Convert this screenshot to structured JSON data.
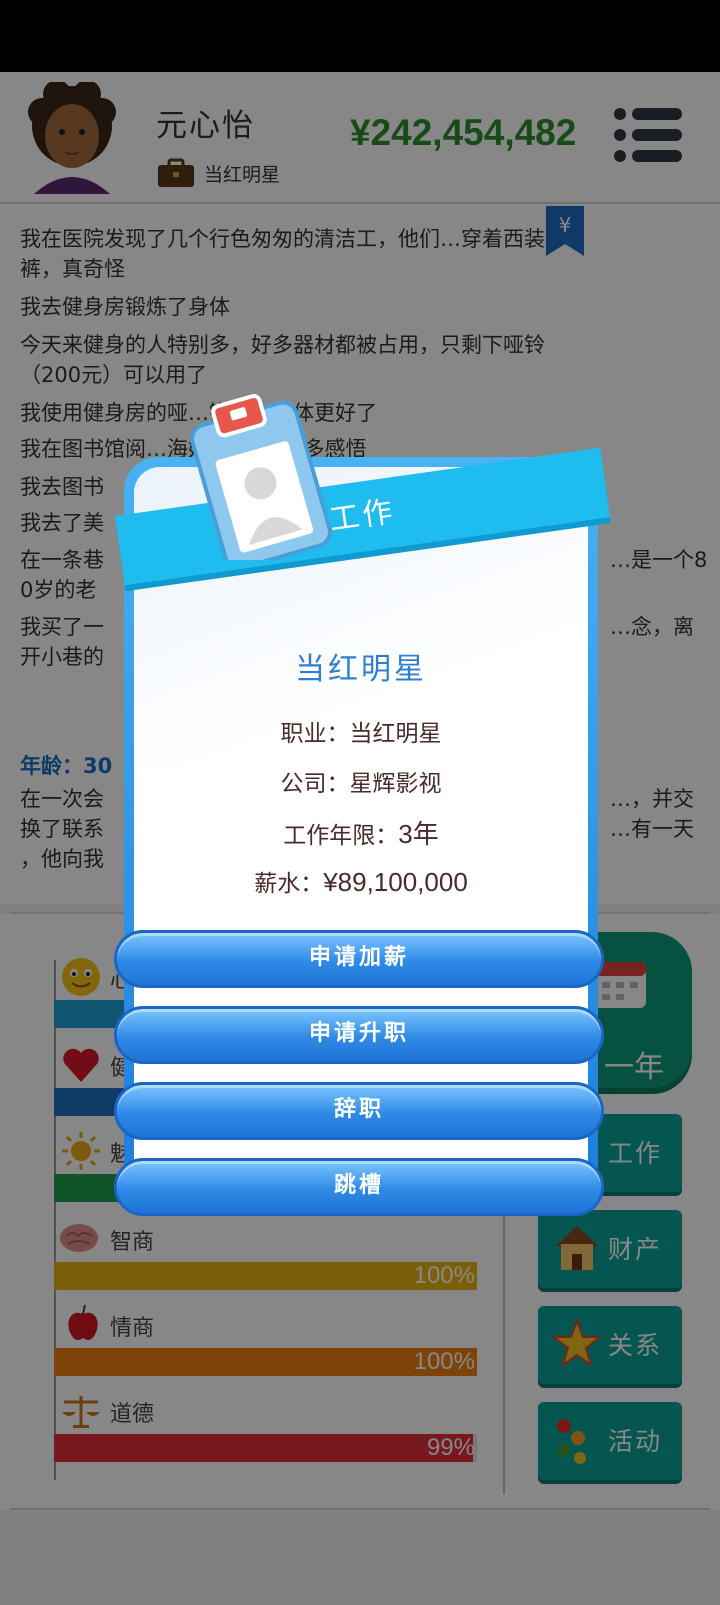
{
  "header": {
    "player_name": "元心怡",
    "job_title": "当红明星",
    "money": "¥242,454,482"
  },
  "log": {
    "lines": [
      "我在医院发现了几个行色匆匆的清洁工，他们…穿着西装",
      "裤，真奇怪",
      "我去健身房锻炼了身体",
      "今天来健身的人特别多，好多器材都被占用，只剩下哑铃",
      "（200元）可以用了",
      "我使用健身房的哑…锻炼，身体更好了",
      "我在图书馆阅…海妖》，有了很多感悟",
      "我去图书",
      "我去了美",
      "在一条巷",
      "0岁的老",
      "我买了一",
      "开小巷的"
    ],
    "right_fragments": [
      "…是一个8",
      "…念，离"
    ],
    "age_label": "年龄：30",
    "tail_lines": [
      "在一次会",
      "换了联系",
      "，他向我"
    ],
    "tail_right": [
      "…，并交",
      "…有一天"
    ]
  },
  "stats": [
    {
      "label": "心情",
      "percent": 100,
      "icon": "smiley-icon",
      "color": "#1e9fd6"
    },
    {
      "label": "健康",
      "percent": 100,
      "icon": "heart-icon",
      "color": "#1d6fc0"
    },
    {
      "label": "魅力",
      "percent": 100,
      "icon": "sun-icon",
      "color": "#1fa04a"
    },
    {
      "label": "智商",
      "percent": 100,
      "icon": "brain-icon",
      "color": "#e8b310",
      "pct_text": "100%"
    },
    {
      "label": "情商",
      "percent": 100,
      "icon": "apple-icon",
      "color": "#ee7f10",
      "pct_text": "100%"
    },
    {
      "label": "道德",
      "percent": 99,
      "icon": "scales-icon",
      "color": "#e0303c",
      "pct_text": "99%"
    }
  ],
  "side_menu": {
    "year_label": "一年",
    "work_label": "工作",
    "property_label": "财产",
    "relations_label": "关系",
    "activities_label": "活动"
  },
  "modal": {
    "ribbon_title": "工作",
    "heading": "当红明星",
    "occupation_label": "职业：",
    "occupation_value": "当红明星",
    "company_label": "公司：",
    "company_value": "星辉影视",
    "years_label": "工作年限：",
    "years_value": "3年",
    "salary_label": "薪水：",
    "salary_value": "¥89,100,000",
    "buttons": {
      "raise": "申请加薪",
      "promotion": "申请升职",
      "resign": "辞职",
      "job_hop": "跳槽"
    }
  },
  "colors": {
    "money_green": "#2f8f2f",
    "modal_blue": "#1b7fdc",
    "ribbon_cyan": "#1fbcf0",
    "tile_teal": "#0aa39a"
  }
}
